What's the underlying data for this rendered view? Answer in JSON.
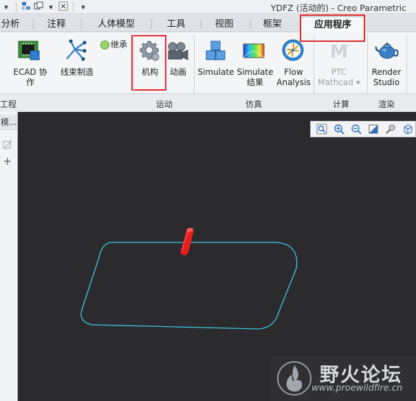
{
  "window": {
    "title": "YDFZ (活动的) - Creo Parametric"
  },
  "quick_access": {
    "icons": [
      "layers-icon",
      "window-switch-icon",
      "dropdown-arrow-icon",
      "close-window-icon",
      "customize-arrow-icon"
    ]
  },
  "tabs": [
    {
      "label": "分析",
      "active": false
    },
    {
      "label": "注释",
      "active": false
    },
    {
      "label": "人体模型",
      "active": false
    },
    {
      "label": "工具",
      "active": false
    },
    {
      "label": "视图",
      "active": false
    },
    {
      "label": "框架",
      "active": false
    },
    {
      "label": "应用程序",
      "active": true
    }
  ],
  "ribbon": {
    "ecad_label": "ECAD 协作",
    "harness_label": "线束制造",
    "inherit_label": "继承",
    "mechanism_label": "机构",
    "animation_label": "动画",
    "simulate_label": "Simulate",
    "simulate_results_label_1": "Simulate",
    "simulate_results_label_2": "结果",
    "flow_label_1": "Flow",
    "flow_label_2": "Analysis",
    "mathcad_label_1": "PTC",
    "mathcad_label_2": "Mathcad",
    "render_label_1": "Render",
    "render_label_2": "Studio"
  },
  "groups": {
    "engineering": "工程",
    "motion": "运动",
    "simulation": "仿真",
    "compute": "计算",
    "render": "渲染"
  },
  "left_panel": {
    "tab_label": "模..."
  },
  "view_toolbar": {
    "icons": [
      "zoom-fit-icon",
      "zoom-in-icon",
      "zoom-out-icon",
      "repaint-icon",
      "shading-icon",
      "view-cube-icon"
    ]
  },
  "watermark": {
    "text": "野火论坛",
    "url": "www.proewildfire.cn"
  },
  "colors": {
    "accent_red": "#e4262b",
    "outline_cyan": "#3ec9ea",
    "part_red": "#e81e1e",
    "viewport_bg": "#2b2b2e"
  }
}
